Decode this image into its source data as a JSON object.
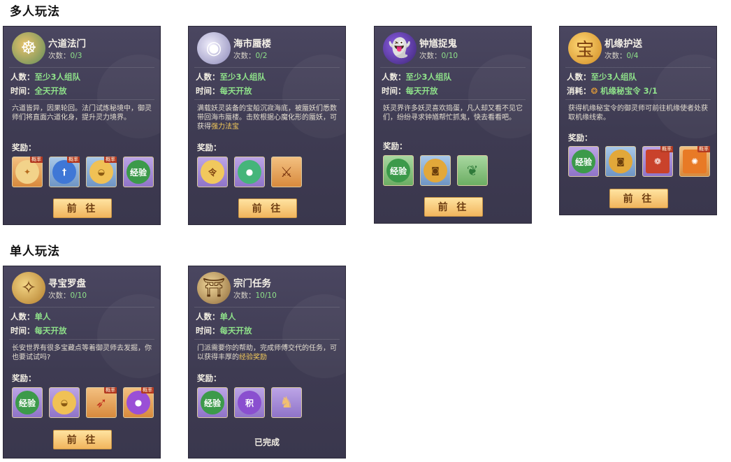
{
  "sections": {
    "multi_title": "多人玩法",
    "single_title": "单人玩法"
  },
  "labels": {
    "count": "次数：",
    "people": "人数：",
    "time": "时间：",
    "cost": "消耗：",
    "reward": "奖励：",
    "prob_tag": "概率",
    "go": "前 往",
    "done": "已完成"
  },
  "cards": [
    {
      "name": "六道法门",
      "count": "0/3",
      "people": "至少3人组队",
      "time": "全天开放",
      "icon": "gate-icon",
      "desc": "六道皆异，因果轮回。法门试炼秘境中，御灵师们将直面六道化身，提升灵力境界。",
      "rewards": [
        {
          "icon": "fan-item-icon",
          "prob": true
        },
        {
          "icon": "sword-orb-icon",
          "prob": true
        },
        {
          "icon": "gold-ingot-icon",
          "prob": true
        },
        {
          "icon": "exp-icon",
          "text": "经验",
          "prob": false
        }
      ]
    },
    {
      "name": "海市蜃楼",
      "count": "0/2",
      "people": "至少3人组队",
      "time": "每天开放",
      "icon": "pearl-shell-icon",
      "desc_pre": "满载妖灵装备的宝船沉寂海底，被蜃妖们悉数带回海市蜃楼。击败根据心魔化形的蜃妖，可获得",
      "desc_hl": "强力法宝",
      "rewards": [
        {
          "icon": "token-icon",
          "prob": false
        },
        {
          "icon": "jade-icon",
          "prob": false
        },
        {
          "icon": "weapons-icon",
          "prob": false
        }
      ]
    },
    {
      "name": "钟馗捉鬼",
      "count": "0/10",
      "people": "至少3人组队",
      "time": "每天开放",
      "icon": "ghost-cat-icon",
      "desc": "妖灵界许多妖灵喜欢捣蛋，凡人却又看不见它们，纷纷寻求钟馗帮忙抓鬼，快去看看吧。",
      "rewards": [
        {
          "icon": "exp-icon",
          "text": "经验",
          "prob": false
        },
        {
          "icon": "coin-icon",
          "prob": false
        },
        {
          "icon": "gourd-leaf-icon",
          "prob": false
        }
      ]
    },
    {
      "name": "机缘护送",
      "count": "0/4",
      "people": "至少3人组队",
      "cost_item": "机缘秘宝令 3/1",
      "icon": "treasure-icon",
      "desc": "获得机缘秘宝令的御灵师可前往机缘使者处获取机缘线索。",
      "rewards": [
        {
          "icon": "exp-icon",
          "text": "经验",
          "prob": false
        },
        {
          "icon": "coin-icon",
          "prob": false
        },
        {
          "icon": "red-book-icon",
          "prob": true
        },
        {
          "icon": "orange-book-icon",
          "prob": true
        }
      ]
    },
    {
      "name": "寻宝罗盘",
      "count": "0/10",
      "people": "单人",
      "time": "每天开放",
      "icon": "compass-icon",
      "desc": "长安世界有很多宝藏点等着御灵师去发掘，你也要试试吗?",
      "rewards": [
        {
          "icon": "exp-icon",
          "text": "经验",
          "prob": false
        },
        {
          "icon": "gold-ingot-icon",
          "prob": false
        },
        {
          "icon": "feather-icon",
          "prob": true
        },
        {
          "icon": "purple-orb-icon",
          "prob": true
        }
      ]
    },
    {
      "name": "宗门任务",
      "count": "10/10",
      "people": "单人",
      "time": "每天开放",
      "icon": "sect-icon",
      "desc_pre": "门派需要你的帮助，完成师傅交代的任务，可以获得丰厚的",
      "desc_hl": "经验奖励",
      "rewards": [
        {
          "icon": "exp-icon",
          "text": "经验",
          "prob": false
        },
        {
          "icon": "points-icon",
          "text": "积",
          "prob": false
        },
        {
          "icon": "gourd-icon",
          "prob": false
        }
      ]
    }
  ]
}
